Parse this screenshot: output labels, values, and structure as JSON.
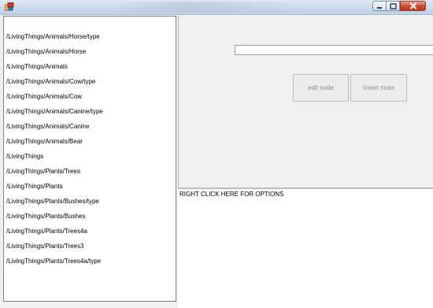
{
  "titlebar": {
    "icons": {
      "app": "app-icon",
      "minimize": "minimize-icon",
      "maximize": "maximize-icon",
      "close": "close-icon"
    }
  },
  "tree_paths": [
    "/LivingThings/Animals/Horse/type",
    "/LivingThings/Animals/Horse",
    "/LivingThings/Animals",
    "/LivingThings/Animals/Cow/type",
    "/LivingThings/Animals/Cow",
    "/LivingThings/Animals/Canine/type",
    "/LivingThings/Animals/Canine",
    "/LivingThings/Animals/Bear",
    "/LivingThings",
    "/LivingThings/Plants/Trees",
    "/LivingThings/Plants",
    "/LivingThings/Plants/Bushes/type",
    "/LivingThings/Plants/Bushes",
    "/LivingThings/Plants/Trees4a",
    "/LivingThings/Plants/Trees3",
    "/LivingThings/Plants/Trees4a/type"
  ],
  "editor": {
    "node_value": "",
    "edit_label": "edit node",
    "insert_label": "Insert node"
  },
  "context_area": {
    "hint": "RIGHT CLICK HERE FOR OPTIONS"
  }
}
